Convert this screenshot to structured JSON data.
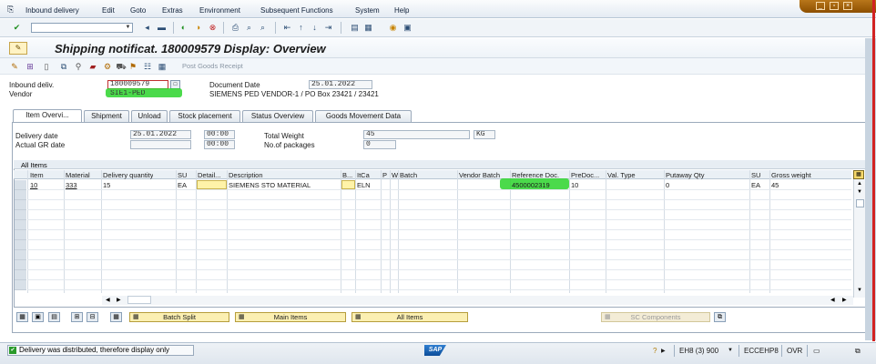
{
  "menu": [
    "Inbound delivery",
    "Edit",
    "Goto",
    "Extras",
    "Environment",
    "Subsequent Functions",
    "System",
    "Help"
  ],
  "title": "Shipping notificat. 180009579 Display: Overview",
  "app_toolbar": {
    "post_goods_receipt": "Post Goods Receipt"
  },
  "header": {
    "inbound_label": "Inbound deliv.",
    "inbound_value": "180009579",
    "vendor_label": "Vendor",
    "vendor_value": "SIE1-PED",
    "doc_date_label": "Document Date",
    "doc_date_value": "25.01.2022",
    "vendor_name": "SIEMENS PED VENDOR-1 / PO Box 23421 / 23421"
  },
  "tabs": [
    "Item Overvi...",
    "Shipment",
    "Unload",
    "Stock placement",
    "Status Overview",
    "Goods Movement Data"
  ],
  "overview": {
    "delivery_date_label": "Delivery date",
    "delivery_date": "25.01.2022",
    "delivery_time": "00:00",
    "actual_gr_label": "Actual GR date",
    "actual_gr_date": "",
    "actual_gr_time": "00:00",
    "total_weight_label": "Total Weight",
    "total_weight": "45",
    "weight_unit": "KG",
    "packages_label": "No.of packages",
    "packages": "0"
  },
  "grid": {
    "title": "All Items",
    "columns": [
      "Item",
      "Material",
      "Delivery quantity",
      "SU",
      "Detail...",
      "Description",
      "B...",
      "ItCa",
      "P",
      "W",
      "Batch",
      "Vendor Batch",
      "Reference Doc.",
      "PreDoc...",
      "Val. Type",
      "Putaway Qty",
      "SU",
      "Gross weight"
    ],
    "row": {
      "item": "10",
      "material": "333",
      "qty": "15",
      "su": "EA",
      "description": "SIEMENS STO MATERIAL",
      "itca": "ELN",
      "ref_doc": "4500002319",
      "predoc": "10",
      "putaway": "0",
      "su2": "EA",
      "gross": "45"
    }
  },
  "buttons": {
    "batch_split": "Batch Split",
    "main_items": "Main Items",
    "all_items": "All Items",
    "sc_components": "SC Components"
  },
  "status": {
    "message": "Delivery was distributed, therefore display only",
    "sap": "SAP",
    "system": "EH8 (3) 900",
    "server": "ECCEHP8",
    "mode": "OVR"
  },
  "colors": {
    "highlight": "#2bd42b",
    "accent": "#b8761a"
  }
}
